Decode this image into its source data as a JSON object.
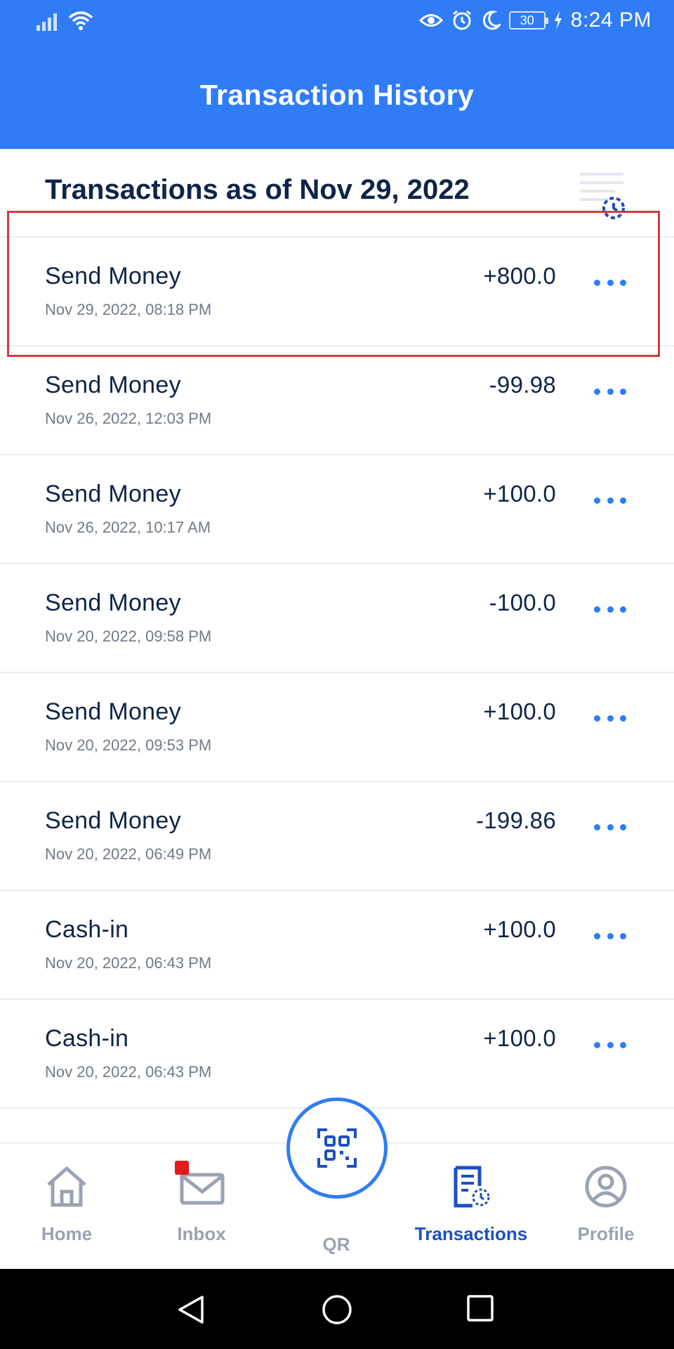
{
  "status_bar": {
    "time": "8:24 PM",
    "battery": "30",
    "icons": [
      "signal-icon",
      "wifi-icon",
      "eye-comfort-icon",
      "alarm-icon",
      "moon-icon",
      "charging-icon"
    ]
  },
  "header": {
    "title": "Transaction History"
  },
  "subheader": {
    "title": "Transactions as of Nov 29, 2022",
    "filter_icon": "filter-history-icon"
  },
  "transactions": [
    {
      "type": "Send Money",
      "date": "Nov 29, 2022, 08:18 PM",
      "amount": "+800.0"
    },
    {
      "type": "Send Money",
      "date": "Nov 26, 2022, 12:03 PM",
      "amount": "-99.98"
    },
    {
      "type": "Send Money",
      "date": "Nov 26, 2022, 10:17 AM",
      "amount": "+100.0"
    },
    {
      "type": "Send Money",
      "date": "Nov 20, 2022, 09:58 PM",
      "amount": "-100.0"
    },
    {
      "type": "Send Money",
      "date": "Nov 20, 2022, 09:53 PM",
      "amount": "+100.0"
    },
    {
      "type": "Send Money",
      "date": "Nov 20, 2022, 06:49 PM",
      "amount": "-199.86"
    },
    {
      "type": "Cash-in",
      "date": "Nov 20, 2022, 06:43 PM",
      "amount": "+100.0"
    },
    {
      "type": "Cash-in",
      "date": "Nov 20, 2022, 06:43 PM",
      "amount": "+100.0"
    }
  ],
  "bottom_nav": {
    "home": "Home",
    "inbox": "Inbox",
    "qr": "QR",
    "transactions": "Transactions",
    "profile": "Profile",
    "active": "transactions"
  },
  "colors": {
    "primary": "#2f7cf6",
    "header_text": "#ffffff",
    "text_dark": "#0f2448",
    "text_muted": "#707a8a",
    "nav_inactive": "#9aa3b2",
    "nav_active": "#1d4fc4",
    "highlight": "#d33a3a",
    "badge": "#e01b1b"
  }
}
